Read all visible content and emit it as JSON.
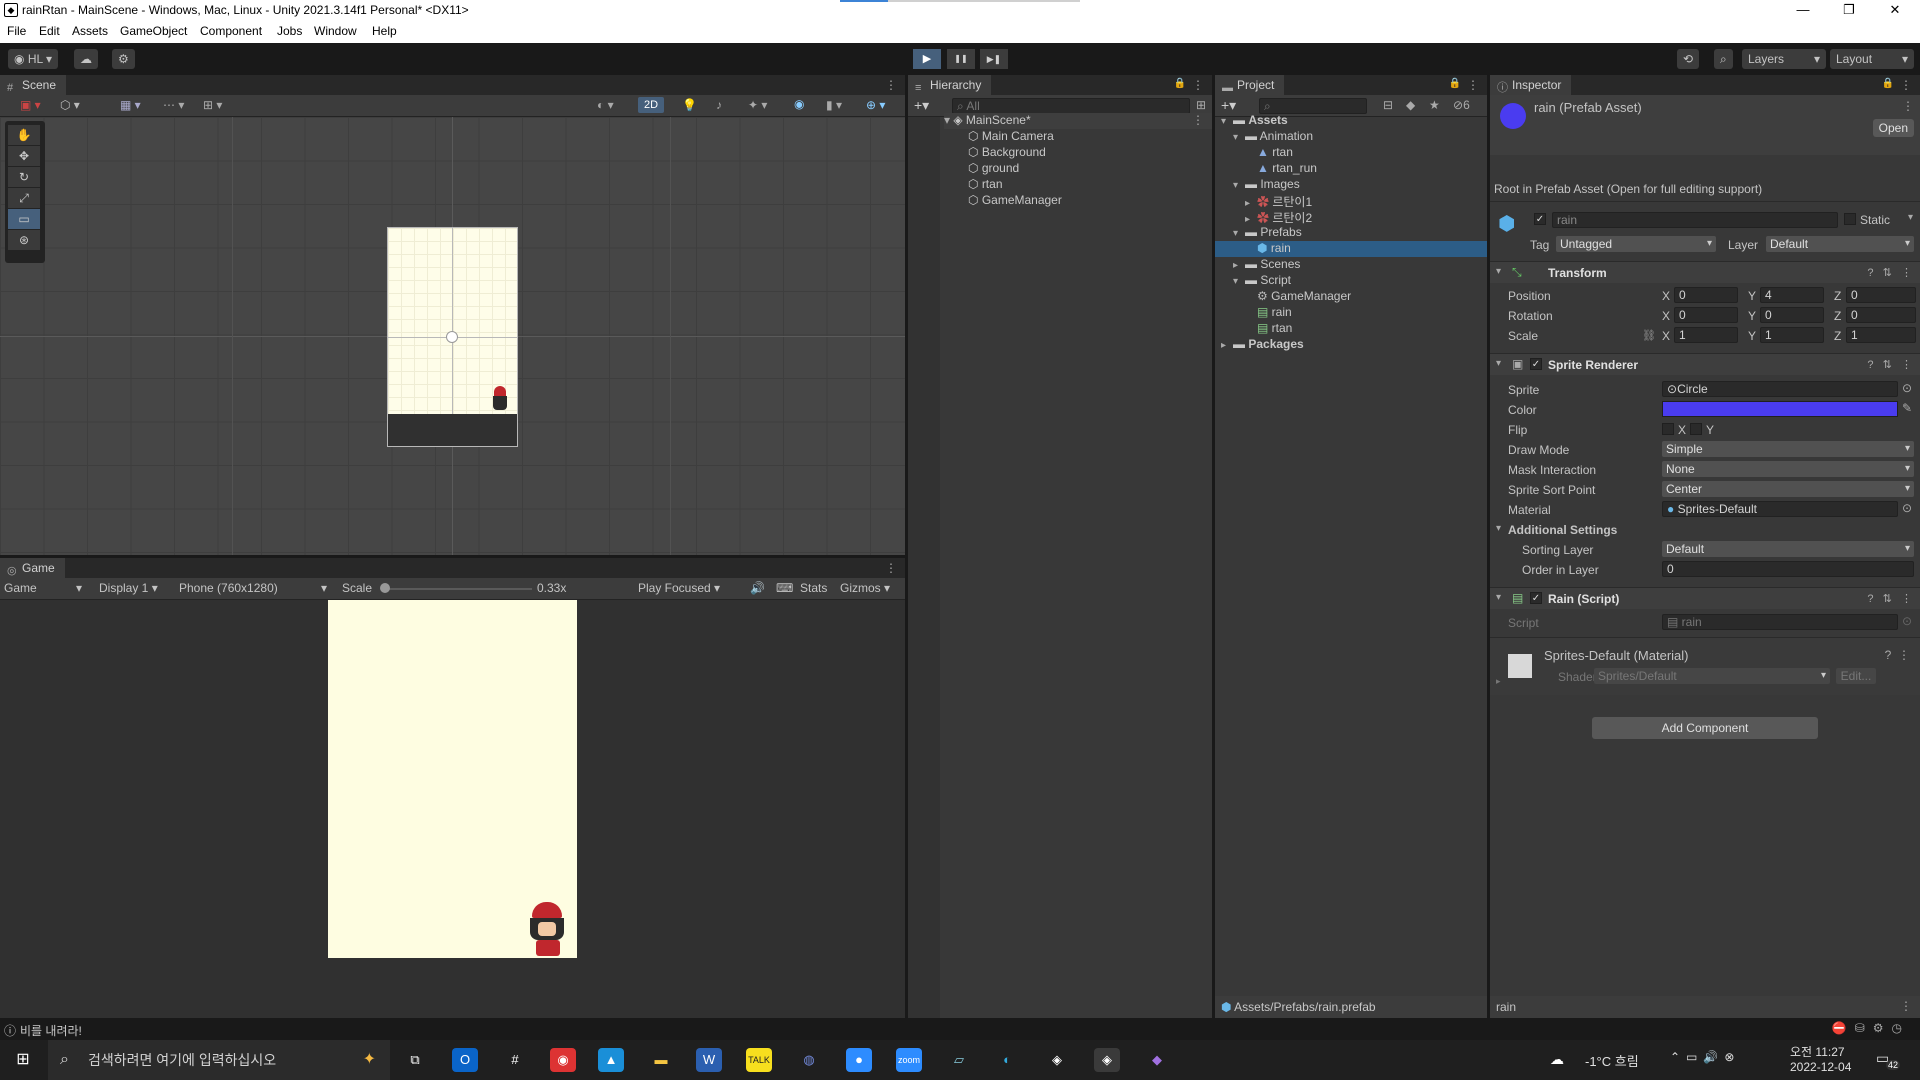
{
  "window": {
    "title": "rainRtan - MainScene - Windows, Mac, Linux - Unity 2021.3.14f1 Personal* <DX11>",
    "icon": "unity-icon",
    "minimize": "—",
    "maximize": "❐",
    "close": "✕"
  },
  "menu": [
    "File",
    "Edit",
    "Assets",
    "GameObject",
    "Component",
    "Jobs",
    "Window",
    "Help"
  ],
  "toolbar": {
    "account": "HL",
    "layers": "Layers",
    "layout": "Layout",
    "play": "▶",
    "pause": "❚❚",
    "step": "▶❚"
  },
  "scene": {
    "tab": "Scene",
    "mode_2d": "2D"
  },
  "game": {
    "tab": "Game",
    "view": "Game",
    "display": "Display 1",
    "resolution": "Phone (760x1280)",
    "scale_label": "Scale",
    "scale_value": "0.33x",
    "play_focused": "Play Focused",
    "stats": "Stats",
    "gizmos": "Gizmos"
  },
  "hierarchy": {
    "tab": "Hierarchy",
    "search_placeholder": "All",
    "scene_name": "MainScene*",
    "items": [
      "Main Camera",
      "Background",
      "ground",
      "rtan",
      "GameManager"
    ]
  },
  "project": {
    "tab": "Project",
    "count": "6",
    "tree": [
      {
        "label": "Assets",
        "level": 0,
        "kind": "folder",
        "open": true
      },
      {
        "label": "Animation",
        "level": 1,
        "kind": "folder",
        "open": true
      },
      {
        "label": "rtan",
        "level": 2,
        "kind": "anim"
      },
      {
        "label": "rtan_run",
        "level": 2,
        "kind": "anim"
      },
      {
        "label": "Images",
        "level": 1,
        "kind": "folder",
        "open": true
      },
      {
        "label": "르탄이1",
        "level": 2,
        "kind": "sprite"
      },
      {
        "label": "르탄이2",
        "level": 2,
        "kind": "sprite"
      },
      {
        "label": "Prefabs",
        "level": 1,
        "kind": "folder",
        "open": true
      },
      {
        "label": "rain",
        "level": 2,
        "kind": "prefab",
        "selected": true
      },
      {
        "label": "Scenes",
        "level": 1,
        "kind": "folder",
        "open": false
      },
      {
        "label": "Script",
        "level": 1,
        "kind": "folder",
        "open": true
      },
      {
        "label": "GameManager",
        "level": 2,
        "kind": "gear"
      },
      {
        "label": "rain",
        "level": 2,
        "kind": "script"
      },
      {
        "label": "rtan",
        "level": 2,
        "kind": "script"
      },
      {
        "label": "Packages",
        "level": 0,
        "kind": "folder",
        "open": false
      }
    ],
    "path": "Assets/Prefabs/rain.prefab"
  },
  "inspector": {
    "tab": "Inspector",
    "asset_title": "rain (Prefab Asset)",
    "open_button": "Open",
    "root_note": "Root in Prefab Asset (Open for full editing support)",
    "object_name": "rain",
    "static_label": "Static",
    "tag_label": "Tag",
    "tag_value": "Untagged",
    "layer_label": "Layer",
    "layer_value": "Default",
    "transform": {
      "title": "Transform",
      "position_label": "Position",
      "position": [
        "0",
        "4",
        "0"
      ],
      "rotation_label": "Rotation",
      "rotation": [
        "0",
        "0",
        "0"
      ],
      "scale_label": "Scale",
      "scale": [
        "1",
        "1",
        "1"
      ]
    },
    "sprite_renderer": {
      "title": "Sprite Renderer",
      "sprite_label": "Sprite",
      "sprite_value": "Circle",
      "color_label": "Color",
      "color_value": "#4a3cf0",
      "flip_label": "Flip",
      "flip_x": "X",
      "flip_y": "Y",
      "draw_mode_label": "Draw Mode",
      "draw_mode": "Simple",
      "mask_label": "Mask Interaction",
      "mask": "None",
      "sort_point_label": "Sprite Sort Point",
      "sort_point": "Center",
      "material_label": "Material",
      "material": "Sprites-Default",
      "additional_label": "Additional Settings",
      "sorting_layer_label": "Sorting Layer",
      "sorting_layer": "Default",
      "order_label": "Order in Layer",
      "order": "0"
    },
    "rain_script": {
      "title": "Rain (Script)",
      "script_label": "Script",
      "script_value": "rain"
    },
    "material": {
      "title": "Sprites-Default (Material)",
      "shader_label": "Shader",
      "shader_value": "Sprites/Default",
      "edit_button": "Edit..."
    },
    "add_component": "Add Component",
    "footer_name": "rain"
  },
  "status": {
    "message": "비를 내려라!"
  },
  "taskbar": {
    "search_placeholder": "검색하려면 여기에 입력하십시오",
    "weather": "-1°C 흐림",
    "time": "오전 11:27",
    "date": "2022-12-04",
    "notifications": "42"
  }
}
